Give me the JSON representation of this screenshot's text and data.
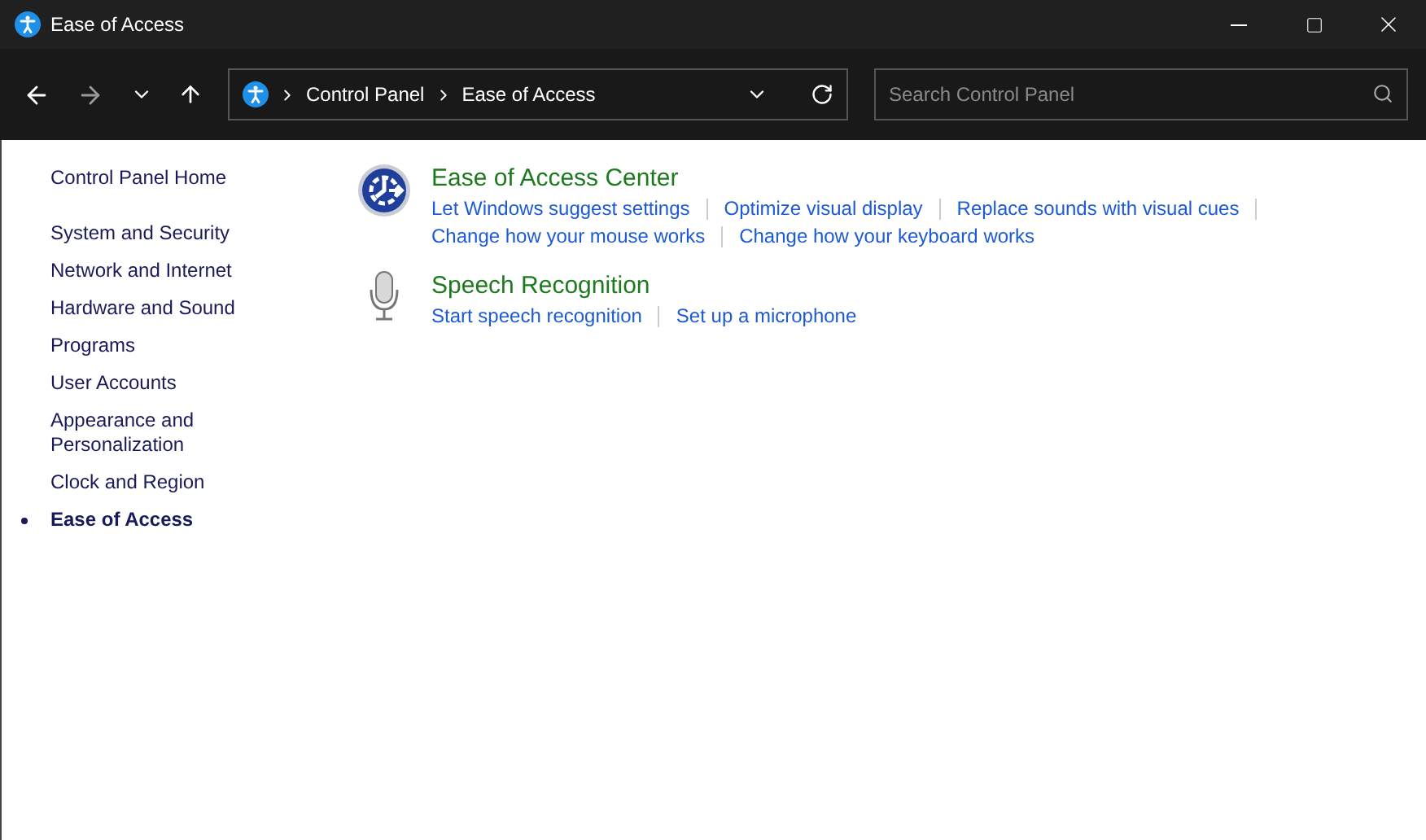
{
  "window": {
    "title": "Ease of Access"
  },
  "address_bar": {
    "crumbs": [
      "Control Panel",
      "Ease of Access"
    ]
  },
  "search": {
    "placeholder": "Search Control Panel"
  },
  "sidebar": {
    "home": "Control Panel Home",
    "items": [
      {
        "label": "System and Security",
        "selected": false
      },
      {
        "label": "Network and Internet",
        "selected": false
      },
      {
        "label": "Hardware and Sound",
        "selected": false
      },
      {
        "label": "Programs",
        "selected": false
      },
      {
        "label": "User Accounts",
        "selected": false
      },
      {
        "label": "Appearance and Personalization",
        "selected": false
      },
      {
        "label": "Clock and Region",
        "selected": false
      },
      {
        "label": "Ease of Access",
        "selected": true
      }
    ]
  },
  "categories": [
    {
      "kind": "access",
      "title": "Ease of Access Center",
      "link_rows": [
        [
          "Let Windows suggest settings",
          "Optimize visual display",
          "Replace sounds with visual cues"
        ],
        [
          "Change how your mouse works",
          "Change how your keyboard works"
        ]
      ]
    },
    {
      "kind": "speech",
      "title": "Speech Recognition",
      "link_rows": [
        [
          "Start speech recognition",
          "Set up a microphone"
        ]
      ]
    }
  ]
}
